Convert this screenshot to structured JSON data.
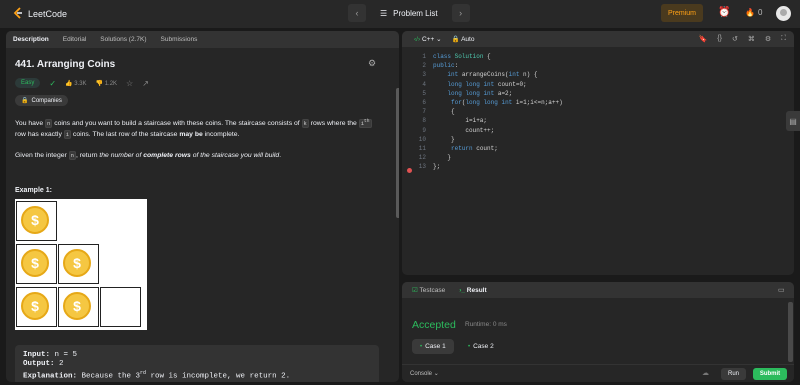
{
  "header": {
    "logo_text": "LeetCode",
    "problem_list_label": "Problem List",
    "premium_label": "Premium",
    "streak_count": "0"
  },
  "description_panel": {
    "tabs": [
      "Description",
      "Editorial",
      "Solutions (2.7K)",
      "Submissions"
    ],
    "title": "441. Arranging Coins",
    "difficulty": "Easy",
    "likes": "3.3K",
    "dislikes": "1.2K",
    "companies_label": "Companies",
    "para1_a": "You have ",
    "para1_n": "n",
    "para1_b": " coins and you want to build a staircase with these coins. The staircase consists of ",
    "para1_k": "k",
    "para1_c": " rows where the ",
    "para1_i": "i",
    "para1_th": "th",
    "para1_d": " row has exactly ",
    "para1_i2": "i",
    "para1_e": " coins. The last row of the staircase ",
    "para1_bold": "may be",
    "para1_f": " incomplete.",
    "para2_a": "Given the integer ",
    "para2_n": "n",
    "para2_b": ", return ",
    "para2_it1": "the number of ",
    "para2_bold": "complete rows",
    "para2_it2": " of the staircase you will build",
    "para2_end": ".",
    "example_title": "Example 1:",
    "coin_symbol": "$",
    "example": {
      "input_label": "Input:",
      "input_value": " n = 5",
      "output_label": "Output:",
      "output_value": " 2",
      "explanation_label": "Explanation:",
      "explanation_a": " Because the 3",
      "explanation_sup": "rd",
      "explanation_b": " row is incomplete, we return 2."
    }
  },
  "editor": {
    "language": "C++",
    "mode": "Auto",
    "lines": [
      "class Solution {",
      "public:",
      "    int arrangeCoins(int n) {",
      "    long long int count=0;",
      "    long long int a=2;",
      "     for(long long int i=1;i<=n;a++)",
      "     {",
      "         i=i+a;",
      "         count++;",
      "     }",
      "     return count;",
      "    }",
      "};"
    ]
  },
  "results": {
    "tabs": [
      "Testcase",
      "Result"
    ],
    "status": "Accepted",
    "runtime": "Runtime: 0 ms",
    "cases": [
      "Case 1",
      "Case 2"
    ],
    "console_label": "Console",
    "run_label": "Run",
    "submit_label": "Submit"
  },
  "colors": {
    "accent": "#ffa116",
    "success": "#2cbb5d",
    "coin": "#f5c742"
  }
}
